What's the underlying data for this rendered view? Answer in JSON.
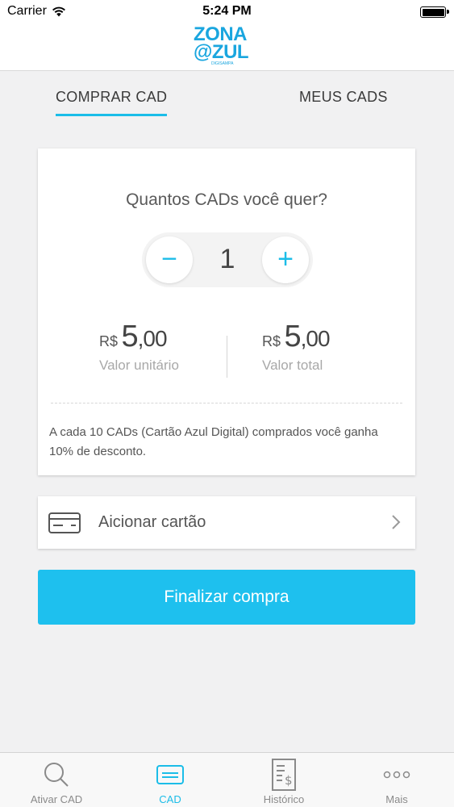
{
  "status_bar": {
    "carrier": "Carrier",
    "time": "5:24 PM"
  },
  "logo": {
    "line1": "ZONA",
    "line2": "@ZUL",
    "tagline": "DIGISAMPA"
  },
  "tabs": [
    {
      "label": "COMPRAR CAD",
      "active": true
    },
    {
      "label": "MEUS CADS",
      "active": false
    }
  ],
  "purchase": {
    "question": "Quantos CADs você quer?",
    "quantity": "1",
    "minus_symbol": "−",
    "plus_symbol": "+",
    "unit_price": {
      "currency": "R$",
      "integer": "5",
      "decimal": ",00",
      "label": "Valor unitário"
    },
    "total_price": {
      "currency": "R$",
      "integer": "5",
      "decimal": ",00",
      "label": "Valor total"
    },
    "note": "A cada 10 CADs (Cartão Azul Digital) comprados você ganha 10% de desconto."
  },
  "add_card": {
    "label": "Aicionar cartão",
    "icon": "credit-card-icon"
  },
  "cta": {
    "label": "Finalizar compra"
  },
  "tab_bar": [
    {
      "label": "Ativar CAD",
      "icon": "search-icon",
      "active": false
    },
    {
      "label": "CAD",
      "icon": "card-icon",
      "active": true
    },
    {
      "label": "Histórico",
      "icon": "receipt-icon",
      "active": false
    },
    {
      "label": "Mais",
      "icon": "more-icon",
      "active": false
    }
  ],
  "colors": {
    "accent": "#1bbde8",
    "cta": "#1ec0ee",
    "logo": "#1aa6df",
    "background": "#f1f1f2"
  }
}
